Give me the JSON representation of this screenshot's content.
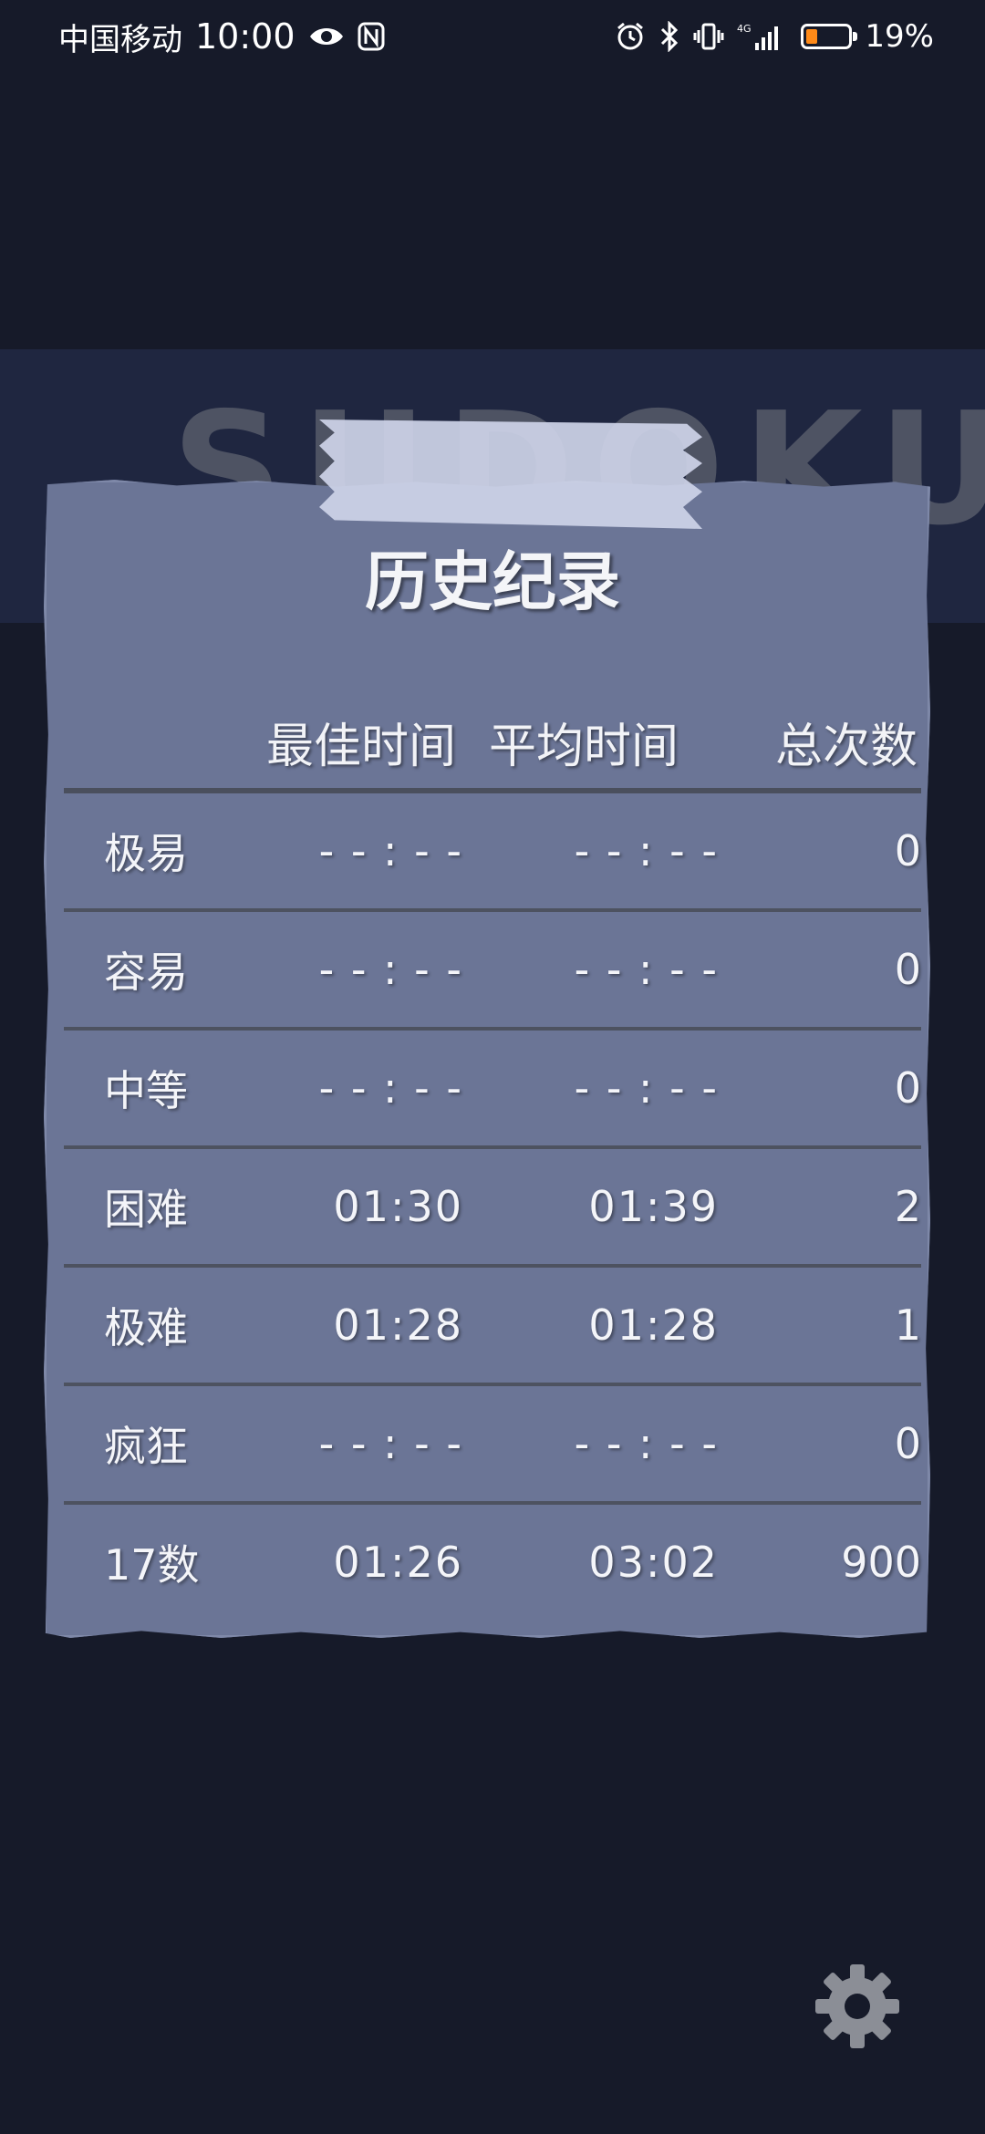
{
  "status_bar": {
    "carrier": "中国移动",
    "time": "10:00",
    "battery_percent": "19%",
    "battery_level": 0.19
  },
  "background_title": "SUDOKU",
  "history": {
    "title": "历史纪录",
    "headers": {
      "best_time": "最佳时间",
      "avg_time": "平均时间",
      "total": "总次数"
    },
    "rows": [
      {
        "level": "极易",
        "best": "- - : - -",
        "avg": "- - : - -",
        "total": "0"
      },
      {
        "level": "容易",
        "best": "- - : - -",
        "avg": "- - : - -",
        "total": "0"
      },
      {
        "level": "中等",
        "best": "- - : - -",
        "avg": "- - : - -",
        "total": "0"
      },
      {
        "level": "困难",
        "best": "01:30",
        "avg": "01:39",
        "total": "2"
      },
      {
        "level": "极难",
        "best": "01:28",
        "avg": "01:28",
        "total": "1"
      },
      {
        "level": "疯狂",
        "best": "- - : - -",
        "avg": "- - : - -",
        "total": "0"
      },
      {
        "level": "17数",
        "best": "01:26",
        "avg": "03:02",
        "total": "900"
      }
    ]
  },
  "colors": {
    "background": "#161a29",
    "card": "#6b7596",
    "battery": "#ff8a18"
  }
}
